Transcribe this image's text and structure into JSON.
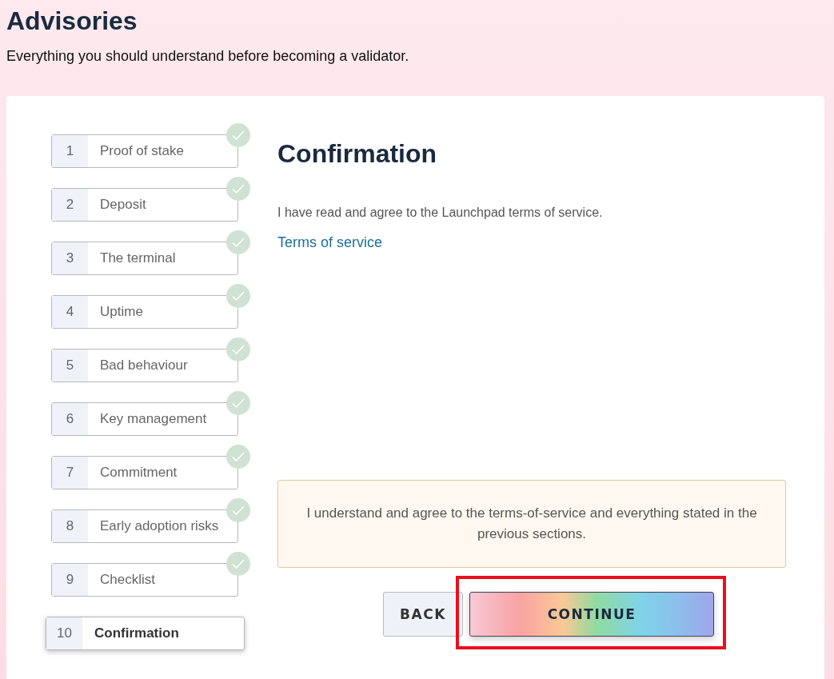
{
  "header": {
    "title": "Advisories",
    "subtitle": "Everything you should understand before becoming a validator."
  },
  "steps": [
    {
      "number": "1",
      "label": "Proof of stake",
      "completed": true,
      "selected": false
    },
    {
      "number": "2",
      "label": "Deposit",
      "completed": true,
      "selected": false
    },
    {
      "number": "3",
      "label": "The terminal",
      "completed": true,
      "selected": false
    },
    {
      "number": "4",
      "label": "Uptime",
      "completed": true,
      "selected": false
    },
    {
      "number": "5",
      "label": "Bad behaviour",
      "completed": true,
      "selected": false
    },
    {
      "number": "6",
      "label": "Key management",
      "completed": true,
      "selected": false
    },
    {
      "number": "7",
      "label": "Commitment",
      "completed": true,
      "selected": false
    },
    {
      "number": "8",
      "label": "Early adoption risks",
      "completed": true,
      "selected": false
    },
    {
      "number": "9",
      "label": "Checklist",
      "completed": true,
      "selected": false
    },
    {
      "number": "10",
      "label": "Confirmation",
      "completed": false,
      "selected": true
    }
  ],
  "content": {
    "title": "Confirmation",
    "text": "I have read and agree to the Launchpad terms of service.",
    "link": "Terms of service"
  },
  "agreement": {
    "text": "I understand and agree to the terms-of-service and everything stated in the previous sections."
  },
  "buttons": [
    {
      "label": "BACK",
      "kind": "secondary",
      "highlighted": false
    },
    {
      "label": "CONTINUE",
      "kind": "primary",
      "highlighted": true
    }
  ]
}
